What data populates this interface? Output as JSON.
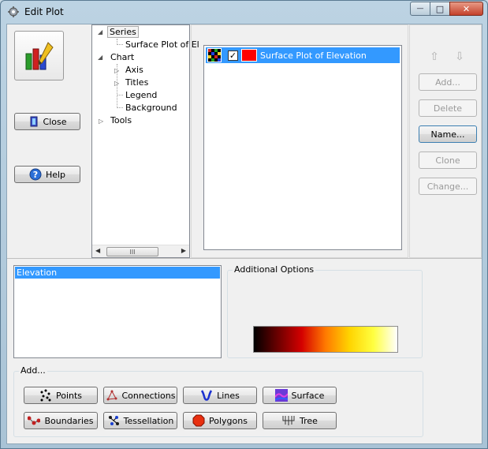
{
  "window": {
    "title": "Edit Plot",
    "controls": {
      "minimize": "—",
      "maximize": "□",
      "close": "✕"
    }
  },
  "left": {
    "close_label": "Close",
    "help_label": "Help"
  },
  "tree": {
    "series": "Series",
    "surface_item": "Surface Plot of El",
    "chart": "Chart",
    "axis": "Axis",
    "titles": "Titles",
    "legend": "Legend",
    "background": "Background",
    "tools": "Tools",
    "scroll_thumb": "III"
  },
  "series_list": {
    "items": [
      {
        "label": "Surface Plot of Elevation",
        "checked": true,
        "color": "#ff0000"
      }
    ]
  },
  "right": {
    "add": "Add...",
    "delete": "Delete",
    "name": "Name...",
    "clone": "Clone",
    "change": "Change..."
  },
  "data_list": {
    "items": [
      "Elevation"
    ]
  },
  "options": {
    "label": "Additional Options"
  },
  "add_group": {
    "label": "Add...",
    "buttons": {
      "points": "Points",
      "connections": "Connections",
      "lines": "Lines",
      "surface": "Surface",
      "boundaries": "Boundaries",
      "tessellation": "Tessellation",
      "polygons": "Polygons",
      "tree": "Tree"
    }
  },
  "colors": {
    "selection": "#3399ff",
    "colormap": [
      "#000000",
      "#6b0000",
      "#d40000",
      "#ff7a00",
      "#ffd400",
      "#ffff40",
      "#ffffff"
    ]
  }
}
